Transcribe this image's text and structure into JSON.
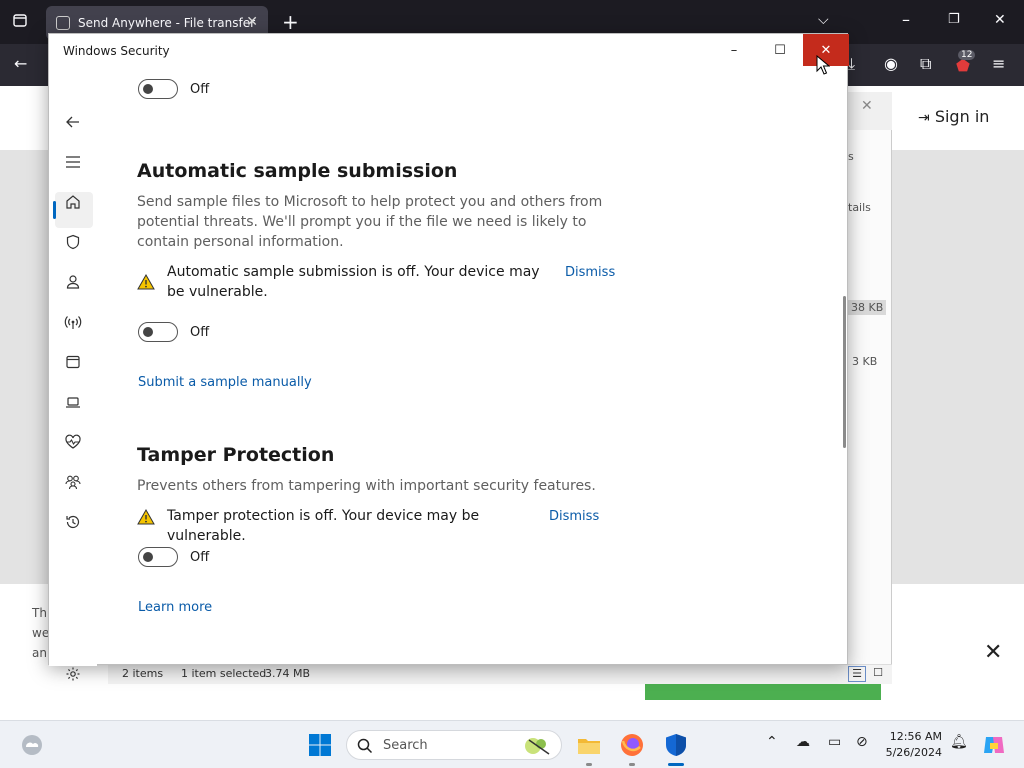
{
  "browser": {
    "tab_title": "Send Anywhere - File transfer",
    "new_tab": "+",
    "extension_badge": "12",
    "sign_in": "Sign in",
    "panel_partial_1": "s",
    "panel_partial_2": "tails",
    "panel_size_1": "38 KB",
    "panel_size_2": "3 KB",
    "bg_text_lines": [
      "Th",
      "we",
      "an"
    ],
    "explorer_status": {
      "items": "2 items",
      "selected": "1 item selected",
      "size": "3.74 MB"
    }
  },
  "security": {
    "window_title": "Windows Security",
    "top_toggle_label": "Off",
    "sample": {
      "heading": "Automatic sample submission",
      "description": "Send sample files to Microsoft to help protect you and others from potential threats. We'll prompt you if the file we need is likely to contain personal information.",
      "warning": "Automatic sample submission is off. Your device may be vulnerable.",
      "dismiss": "Dismiss",
      "toggle_label": "Off",
      "link": "Submit a sample manually"
    },
    "tamper": {
      "heading": "Tamper Protection",
      "description": "Prevents others from tampering with important security features.",
      "warning": "Tamper protection is off. Your device may be vulnerable.",
      "dismiss": "Dismiss",
      "toggle_label": "Off",
      "link": "Learn more"
    },
    "nav_icons": [
      "back-arrow-icon",
      "hamburger-menu-icon",
      "home-icon",
      "shield-icon",
      "person-icon",
      "wireless-icon",
      "app-browser-icon",
      "laptop-icon",
      "heart-pulse-icon",
      "family-icon",
      "history-icon",
      "settings-gear-icon"
    ],
    "accent_color": "#0067c0",
    "close_color": "#c42b1c",
    "warning_color": "#f5c400"
  },
  "taskbar": {
    "search_placeholder": "Search",
    "time": "12:56 AM",
    "date": "5/26/2024"
  }
}
